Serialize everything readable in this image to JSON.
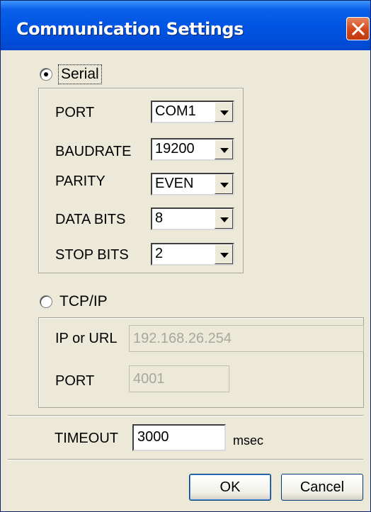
{
  "window": {
    "title": "Communication Settings"
  },
  "serial": {
    "label": "Serial",
    "selected": true,
    "fields": [
      {
        "label": "PORT",
        "value": "COM1"
      },
      {
        "label": "BAUDRATE",
        "value": "19200"
      },
      {
        "label": "PARITY",
        "value": "EVEN"
      },
      {
        "label": "DATA BITS",
        "value": "8"
      },
      {
        "label": "STOP BITS",
        "value": "2"
      }
    ]
  },
  "tcpip": {
    "label": "TCP/IP",
    "selected": false,
    "ip_label": "IP or URL",
    "ip_value": "192.168.26.254",
    "port_label": "PORT",
    "port_value": "4001"
  },
  "timeout": {
    "label": "TIMEOUT",
    "value": "3000",
    "unit": "msec"
  },
  "buttons": {
    "ok": "OK",
    "cancel": "Cancel"
  },
  "icons": {
    "close": "close-icon",
    "dropdown": "chevron-down-icon"
  },
  "colors": {
    "titlebar": "#0054E3",
    "close": "#D3481C",
    "face": "#ECE9D8"
  }
}
